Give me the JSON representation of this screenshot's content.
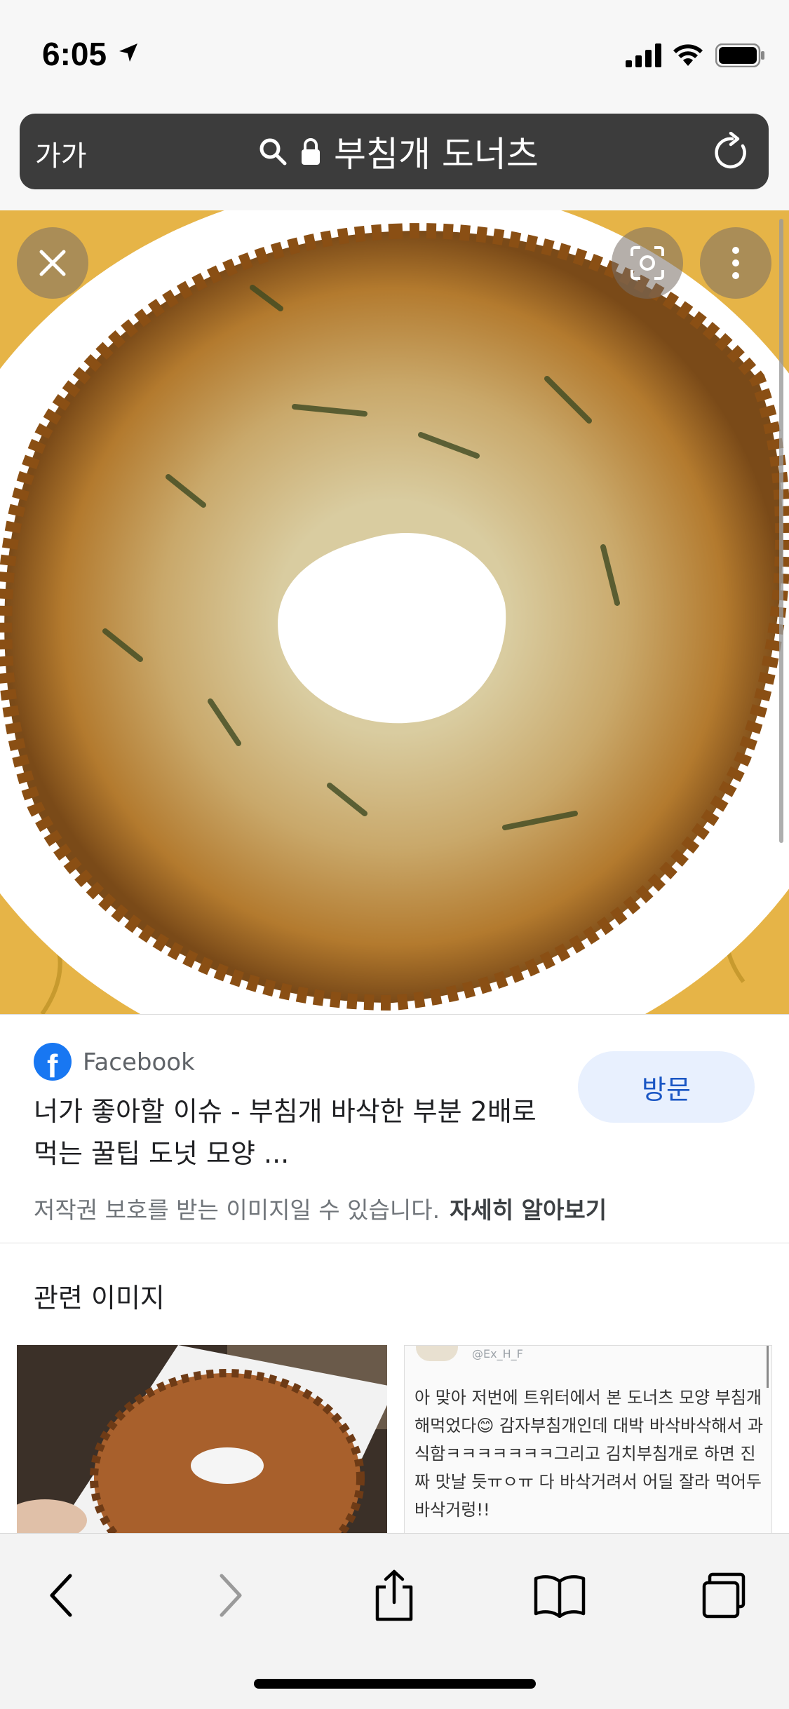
{
  "status_bar": {
    "time": "6:05"
  },
  "address_bar": {
    "text_size_label": "가가",
    "url_text": "부침개 도너츠"
  },
  "viewer": {
    "close_icon": "close-icon",
    "lens_icon": "lens-icon",
    "more_icon": "more-vertical-icon"
  },
  "result": {
    "source": "Facebook",
    "title": "너가 좋아할 이슈 - 부침개 바삭한 부분 2배로 먹는 꿀팁 도넛 모양 ...",
    "visit_label": "방문",
    "copyright_notice": "저작권 보호를 받는 이미지일 수 있습니다.",
    "learn_more": "자세히 알아보기"
  },
  "related": {
    "title": "관련 이미지",
    "tweet_handle": "@Ex_H_F",
    "tweet_text": "아 맞아 저번에 트위터에서 본 도너츠 모양 부침개 해먹었다😊 감자부침개인데 대박 바삭바삭해서 과식함ㅋㅋㅋㅋㅋㅋㅋ그리고 김치부침개로 하면 진짜 맛날 듯ㅠㅇㅠ 다 바삭거려서 어딜 잘라 먹어두 바삭거렁!!"
  },
  "toolbar": {
    "back_icon": "back-icon",
    "forward_icon": "forward-icon",
    "share_icon": "share-icon",
    "bookmarks_icon": "bookmarks-icon",
    "tabs_icon": "tabs-icon"
  }
}
